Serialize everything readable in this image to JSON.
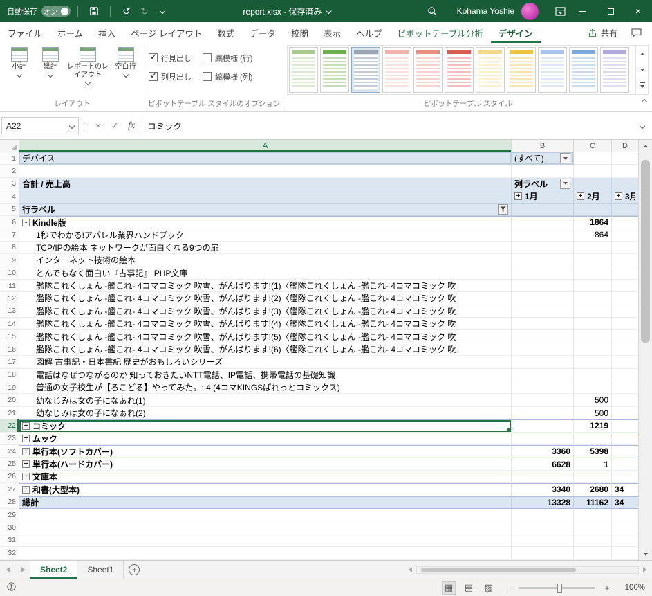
{
  "colors": {
    "titlebar": "#185c37",
    "accent": "#217346",
    "pivot_blue": "#dce6f1"
  },
  "icons": {
    "cancel": "×",
    "enter": "✓",
    "undo": "↺",
    "redo": "↻",
    "zoom_in": "+",
    "zoom_out": "−",
    "new_sheet": "+",
    "view_normal": "▦",
    "view_layout": "▤",
    "view_break": "▧",
    "grip": "⁞",
    "close": "×"
  },
  "titlebar": {
    "autosave_label": "自動保存",
    "autosave_state": "オン",
    "doc_title": "report.xlsx - 保存済み",
    "user_name": "Kohama Yoshie"
  },
  "tabrow": {
    "share_label": "共有"
  },
  "ribbon_tabs": [
    {
      "id": "file",
      "label": "ファイル"
    },
    {
      "id": "home",
      "label": "ホーム"
    },
    {
      "id": "insert",
      "label": "挿入"
    },
    {
      "id": "page-layout",
      "label": "ページ レイアウト"
    },
    {
      "id": "formulas",
      "label": "数式"
    },
    {
      "id": "data",
      "label": "データ"
    },
    {
      "id": "review",
      "label": "校閲"
    },
    {
      "id": "view",
      "label": "表示"
    },
    {
      "id": "help",
      "label": "ヘルプ"
    },
    {
      "id": "pivot-analyze",
      "label": "ピボットテーブル分析",
      "contextual": true
    },
    {
      "id": "design",
      "label": "デザイン",
      "contextual": true,
      "active": true
    }
  ],
  "ribbon": {
    "layout_group": {
      "label": "レイアウト",
      "buttons": [
        {
          "id": "subtotals",
          "label": "小計"
        },
        {
          "id": "grand-totals",
          "label": "総計"
        },
        {
          "id": "report-layout",
          "label": "レポートのレイアウト"
        },
        {
          "id": "blank-rows",
          "label": "空白行"
        }
      ]
    },
    "options_group": {
      "label": "ピボットテーブル スタイルのオプション",
      "checkboxes": [
        {
          "id": "row-headers",
          "label": "行見出し",
          "checked": true
        },
        {
          "id": "col-headers",
          "label": "列見出し",
          "checked": true
        },
        {
          "id": "banded-rows",
          "label": "縞模様 (行)",
          "checked": false
        },
        {
          "id": "banded-cols",
          "label": "縞模様 (列)",
          "checked": false
        }
      ]
    },
    "styles_group": {
      "label": "ピボットテーブル スタイル",
      "thumbnails": [
        {
          "accent": "#a9c98f"
        },
        {
          "accent": "#6fae4e"
        },
        {
          "accent": "#9aa5b1",
          "selected": true
        },
        {
          "accent": "#f2b5ad"
        },
        {
          "accent": "#e88d82"
        },
        {
          "accent": "#d95f55"
        },
        {
          "accent": "#f5d98a"
        },
        {
          "accent": "#eec33f"
        },
        {
          "accent": "#a8c4e8"
        },
        {
          "accent": "#7fa7dc"
        },
        {
          "accent": "#b2a8d8"
        }
      ]
    }
  },
  "formula_bar": {
    "name_box": "A22",
    "fx_label": "fx",
    "formula": "コミック"
  },
  "grid": {
    "columns": [
      "A",
      "B",
      "C",
      "D"
    ],
    "selected_col": "A",
    "rows": [
      {
        "n": 1,
        "a": {
          "text": "デバイス",
          "bg": "blue",
          "boxed": true
        },
        "b": {
          "text": "(すべて)",
          "bg": "blue",
          "drop": true,
          "boxed": true
        }
      },
      {
        "n": 2
      },
      {
        "n": 3,
        "a": {
          "text": "合計 / 売上高",
          "bold": true,
          "bg": "blue"
        },
        "b": {
          "text": "列ラベル",
          "bold": true,
          "bg": "blue",
          "drop": true
        },
        "c": {
          "bg": "blue"
        },
        "d": {
          "bg": "blue"
        }
      },
      {
        "n": 4,
        "a": {
          "bg": "blue"
        },
        "b": {
          "text": "1月",
          "bold": true,
          "bg": "blue",
          "btn": "+"
        },
        "c": {
          "text": "2月",
          "bold": true,
          "bg": "blue",
          "btn": "+"
        },
        "d": {
          "text": "3月",
          "bold": true,
          "bg": "blue",
          "btn": "+"
        }
      },
      {
        "n": 5,
        "a": {
          "text": "行ラベル",
          "bold": true,
          "bg": "blue",
          "filter": true
        },
        "b": {
          "bg": "blue"
        },
        "c": {
          "bg": "blue"
        },
        "d": {
          "bg": "blue"
        }
      },
      {
        "n": 6,
        "top": true,
        "a": {
          "text": "Kindle版",
          "bold": true,
          "btn": "-"
        },
        "c": {
          "text": "1864",
          "bold": true
        }
      },
      {
        "n": 7,
        "a": {
          "text": "1秒でわかる!アパレル業界ハンドブック",
          "indent": true
        },
        "c": {
          "text": "864"
        }
      },
      {
        "n": 8,
        "a": {
          "text": "TCP/IPの絵本 ネットワークが面白くなる9つの扉",
          "indent": true
        }
      },
      {
        "n": 9,
        "a": {
          "text": "インターネット技術の絵本",
          "indent": true
        }
      },
      {
        "n": 10,
        "a": {
          "text": "とんでもなく面白い『古事記』 PHP文庫",
          "indent": true
        }
      },
      {
        "n": 11,
        "a": {
          "text": "艦隊これくしょん -艦これ- 4コマコミック 吹雪、がんばります!(1)〈艦隊これくしょん -艦これ- 4コマコミック 吹",
          "indent": true
        }
      },
      {
        "n": 12,
        "a": {
          "text": "艦隊これくしょん -艦これ- 4コマコミック 吹雪、がんばります!(2)〈艦隊これくしょん -艦これ- 4コマコミック 吹",
          "indent": true
        }
      },
      {
        "n": 13,
        "a": {
          "text": "艦隊これくしょん -艦これ- 4コマコミック 吹雪、がんばります!(3)〈艦隊これくしょん -艦これ- 4コマコミック 吹",
          "indent": true
        }
      },
      {
        "n": 14,
        "a": {
          "text": "艦隊これくしょん -艦これ- 4コマコミック 吹雪、がんばります!(4)〈艦隊これくしょん -艦これ- 4コマコミック 吹",
          "indent": true
        }
      },
      {
        "n": 15,
        "a": {
          "text": "艦隊これくしょん -艦これ- 4コマコミック 吹雪、がんばります!(5)〈艦隊これくしょん -艦これ- 4コマコミック 吹",
          "indent": true
        }
      },
      {
        "n": 16,
        "a": {
          "text": "艦隊これくしょん -艦これ- 4コマコミック 吹雪、がんばります!(6)〈艦隊これくしょん -艦これ- 4コマコミック 吹",
          "indent": true
        }
      },
      {
        "n": 17,
        "a": {
          "text": "図解 古事記・日本書紀 歴史がおもしろいシリーズ",
          "indent": true
        }
      },
      {
        "n": 18,
        "a": {
          "text": "電話はなぜつながるのか 知っておきたいNTT電話、IP電話、携帯電話の基礎知識",
          "indent": true
        }
      },
      {
        "n": 19,
        "a": {
          "text": "普通の女子校生が【ろこどる】やってみた。: 4 (4コマKINGSぱれっとコミックス)",
          "indent": true
        }
      },
      {
        "n": 20,
        "a": {
          "text": "幼なじみは女の子になぁれ(1)",
          "indent": true
        },
        "c": {
          "text": "500"
        }
      },
      {
        "n": 21,
        "a": {
          "text": "幼なじみは女の子になぁれ(2)",
          "indent": true
        },
        "c": {
          "text": "500"
        }
      },
      {
        "n": 22,
        "top": true,
        "sel": true,
        "a": {
          "text": "コミック",
          "bold": true,
          "btn": "+",
          "selected": true
        },
        "c": {
          "text": "1219",
          "bold": true
        }
      },
      {
        "n": 23,
        "top": true,
        "a": {
          "text": "ムック",
          "bold": true,
          "btn": "+"
        }
      },
      {
        "n": 24,
        "top": true,
        "a": {
          "text": "単行本(ソフトカバー)",
          "bold": true,
          "btn": "+"
        },
        "b": {
          "text": "3360",
          "bold": true
        },
        "c": {
          "text": "5398",
          "bold": true
        }
      },
      {
        "n": 25,
        "top": true,
        "a": {
          "text": "単行本(ハードカバー)",
          "bold": true,
          "btn": "+"
        },
        "b": {
          "text": "6628",
          "bold": true
        },
        "c": {
          "text": "1",
          "bold": true
        }
      },
      {
        "n": 26,
        "top": true,
        "a": {
          "text": "文庫本",
          "bold": true,
          "btn": "+"
        }
      },
      {
        "n": 27,
        "top": true,
        "a": {
          "text": "和書(大型本)",
          "bold": true,
          "btn": "+"
        },
        "b": {
          "text": "3340",
          "bold": true
        },
        "c": {
          "text": "2680",
          "bold": true
        },
        "d": {
          "text": "34",
          "bold": true
        }
      },
      {
        "n": 28,
        "top": true,
        "bottom": true,
        "a": {
          "text": "総計",
          "bold": true,
          "bg": "blue"
        },
        "b": {
          "text": "13328",
          "bold": true,
          "bg": "blue"
        },
        "c": {
          "text": "11162",
          "bold": true,
          "bg": "blue"
        },
        "d": {
          "text": "34",
          "bold": true,
          "bg": "blue"
        }
      },
      {
        "n": 29
      },
      {
        "n": 30
      },
      {
        "n": 31
      },
      {
        "n": 32
      }
    ]
  },
  "sheet_tabs": [
    {
      "id": "sheet2",
      "label": "Sheet2",
      "active": true
    },
    {
      "id": "sheet1",
      "label": "Sheet1"
    }
  ],
  "status_bar": {
    "zoom": "100%"
  }
}
